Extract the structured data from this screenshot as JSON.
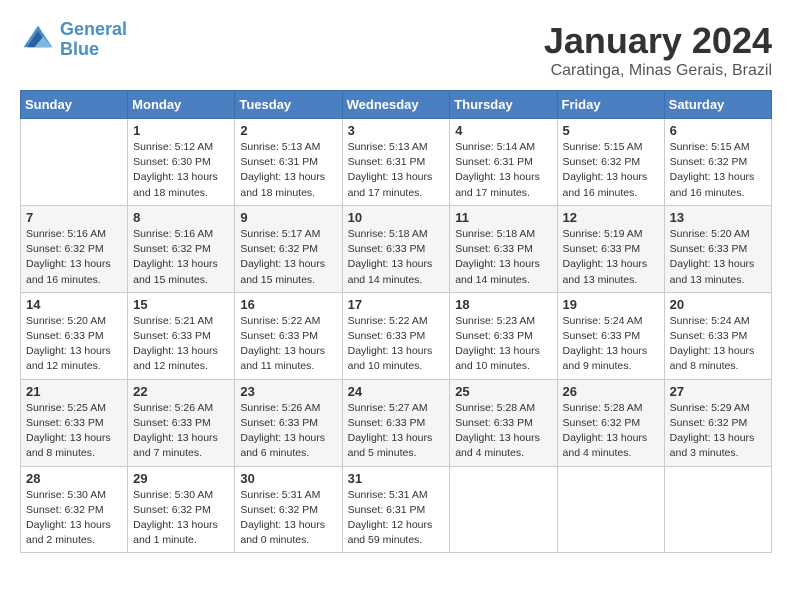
{
  "logo": {
    "line1": "General",
    "line2": "Blue"
  },
  "title": "January 2024",
  "location": "Caratinga, Minas Gerais, Brazil",
  "days_of_week": [
    "Sunday",
    "Monday",
    "Tuesday",
    "Wednesday",
    "Thursday",
    "Friday",
    "Saturday"
  ],
  "weeks": [
    [
      {
        "day": "",
        "info": ""
      },
      {
        "day": "1",
        "info": "Sunrise: 5:12 AM\nSunset: 6:30 PM\nDaylight: 13 hours\nand 18 minutes."
      },
      {
        "day": "2",
        "info": "Sunrise: 5:13 AM\nSunset: 6:31 PM\nDaylight: 13 hours\nand 18 minutes."
      },
      {
        "day": "3",
        "info": "Sunrise: 5:13 AM\nSunset: 6:31 PM\nDaylight: 13 hours\nand 17 minutes."
      },
      {
        "day": "4",
        "info": "Sunrise: 5:14 AM\nSunset: 6:31 PM\nDaylight: 13 hours\nand 17 minutes."
      },
      {
        "day": "5",
        "info": "Sunrise: 5:15 AM\nSunset: 6:32 PM\nDaylight: 13 hours\nand 16 minutes."
      },
      {
        "day": "6",
        "info": "Sunrise: 5:15 AM\nSunset: 6:32 PM\nDaylight: 13 hours\nand 16 minutes."
      }
    ],
    [
      {
        "day": "7",
        "info": "Sunrise: 5:16 AM\nSunset: 6:32 PM\nDaylight: 13 hours\nand 16 minutes."
      },
      {
        "day": "8",
        "info": "Sunrise: 5:16 AM\nSunset: 6:32 PM\nDaylight: 13 hours\nand 15 minutes."
      },
      {
        "day": "9",
        "info": "Sunrise: 5:17 AM\nSunset: 6:32 PM\nDaylight: 13 hours\nand 15 minutes."
      },
      {
        "day": "10",
        "info": "Sunrise: 5:18 AM\nSunset: 6:33 PM\nDaylight: 13 hours\nand 14 minutes."
      },
      {
        "day": "11",
        "info": "Sunrise: 5:18 AM\nSunset: 6:33 PM\nDaylight: 13 hours\nand 14 minutes."
      },
      {
        "day": "12",
        "info": "Sunrise: 5:19 AM\nSunset: 6:33 PM\nDaylight: 13 hours\nand 13 minutes."
      },
      {
        "day": "13",
        "info": "Sunrise: 5:20 AM\nSunset: 6:33 PM\nDaylight: 13 hours\nand 13 minutes."
      }
    ],
    [
      {
        "day": "14",
        "info": "Sunrise: 5:20 AM\nSunset: 6:33 PM\nDaylight: 13 hours\nand 12 minutes."
      },
      {
        "day": "15",
        "info": "Sunrise: 5:21 AM\nSunset: 6:33 PM\nDaylight: 13 hours\nand 12 minutes."
      },
      {
        "day": "16",
        "info": "Sunrise: 5:22 AM\nSunset: 6:33 PM\nDaylight: 13 hours\nand 11 minutes."
      },
      {
        "day": "17",
        "info": "Sunrise: 5:22 AM\nSunset: 6:33 PM\nDaylight: 13 hours\nand 10 minutes."
      },
      {
        "day": "18",
        "info": "Sunrise: 5:23 AM\nSunset: 6:33 PM\nDaylight: 13 hours\nand 10 minutes."
      },
      {
        "day": "19",
        "info": "Sunrise: 5:24 AM\nSunset: 6:33 PM\nDaylight: 13 hours\nand 9 minutes."
      },
      {
        "day": "20",
        "info": "Sunrise: 5:24 AM\nSunset: 6:33 PM\nDaylight: 13 hours\nand 8 minutes."
      }
    ],
    [
      {
        "day": "21",
        "info": "Sunrise: 5:25 AM\nSunset: 6:33 PM\nDaylight: 13 hours\nand 8 minutes."
      },
      {
        "day": "22",
        "info": "Sunrise: 5:26 AM\nSunset: 6:33 PM\nDaylight: 13 hours\nand 7 minutes."
      },
      {
        "day": "23",
        "info": "Sunrise: 5:26 AM\nSunset: 6:33 PM\nDaylight: 13 hours\nand 6 minutes."
      },
      {
        "day": "24",
        "info": "Sunrise: 5:27 AM\nSunset: 6:33 PM\nDaylight: 13 hours\nand 5 minutes."
      },
      {
        "day": "25",
        "info": "Sunrise: 5:28 AM\nSunset: 6:33 PM\nDaylight: 13 hours\nand 4 minutes."
      },
      {
        "day": "26",
        "info": "Sunrise: 5:28 AM\nSunset: 6:32 PM\nDaylight: 13 hours\nand 4 minutes."
      },
      {
        "day": "27",
        "info": "Sunrise: 5:29 AM\nSunset: 6:32 PM\nDaylight: 13 hours\nand 3 minutes."
      }
    ],
    [
      {
        "day": "28",
        "info": "Sunrise: 5:30 AM\nSunset: 6:32 PM\nDaylight: 13 hours\nand 2 minutes."
      },
      {
        "day": "29",
        "info": "Sunrise: 5:30 AM\nSunset: 6:32 PM\nDaylight: 13 hours\nand 1 minute."
      },
      {
        "day": "30",
        "info": "Sunrise: 5:31 AM\nSunset: 6:32 PM\nDaylight: 13 hours\nand 0 minutes."
      },
      {
        "day": "31",
        "info": "Sunrise: 5:31 AM\nSunset: 6:31 PM\nDaylight: 12 hours\nand 59 minutes."
      },
      {
        "day": "",
        "info": ""
      },
      {
        "day": "",
        "info": ""
      },
      {
        "day": "",
        "info": ""
      }
    ]
  ]
}
